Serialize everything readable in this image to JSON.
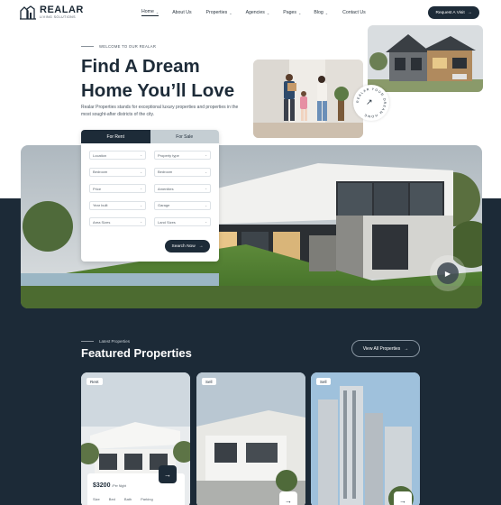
{
  "brand": {
    "name": "REALAR",
    "tagline": "LIVING SOLUTIONS"
  },
  "nav": {
    "items": [
      {
        "label": "Home",
        "dropdown": true,
        "active": true
      },
      {
        "label": "About Us",
        "dropdown": false
      },
      {
        "label": "Properties",
        "dropdown": true
      },
      {
        "label": "Agencies",
        "dropdown": true
      },
      {
        "label": "Pages",
        "dropdown": true
      },
      {
        "label": "Blog",
        "dropdown": true
      },
      {
        "label": "Contact Us",
        "dropdown": false
      }
    ],
    "cta": "Request A Visit"
  },
  "hero": {
    "eyebrow": "WELCOME TO OUR REALAR",
    "title_line1": "Find A Dream",
    "title_line2": "Home You’ll Love",
    "description": "Realar Properties stands for exceptional luxury properties and properties in the most sought-after districts of the city.",
    "badge_text": "REALAR YOUR DREAM HOME"
  },
  "search": {
    "tabs": [
      "For Rent",
      "For Sale"
    ],
    "active_tab": 0,
    "fields": [
      "Location",
      "Property type",
      "Bedroom",
      "Bedroom",
      "Price",
      "Amenities",
      "Year built",
      "Garage",
      "Area Sizes",
      "Land Sizes"
    ],
    "button": "Search Now"
  },
  "featured": {
    "eyebrow": "Latest Properties",
    "title": "Featured Properties",
    "view_all": "View All Properties",
    "cards": [
      {
        "badge": "Rent",
        "price": "$3200",
        "unit": "/Per Night",
        "specs": [
          "Size",
          "Bed",
          "Bath",
          "Parking"
        ]
      },
      {
        "badge": "Sell"
      },
      {
        "badge": "Sell"
      }
    ]
  },
  "colors": {
    "navy": "#1c2a37",
    "white": "#ffffff",
    "tab_inactive": "#c5ced3"
  },
  "icons": [
    "arrow-right-icon",
    "chevron-down-icon",
    "play-icon",
    "arrow-up-right-icon"
  ]
}
